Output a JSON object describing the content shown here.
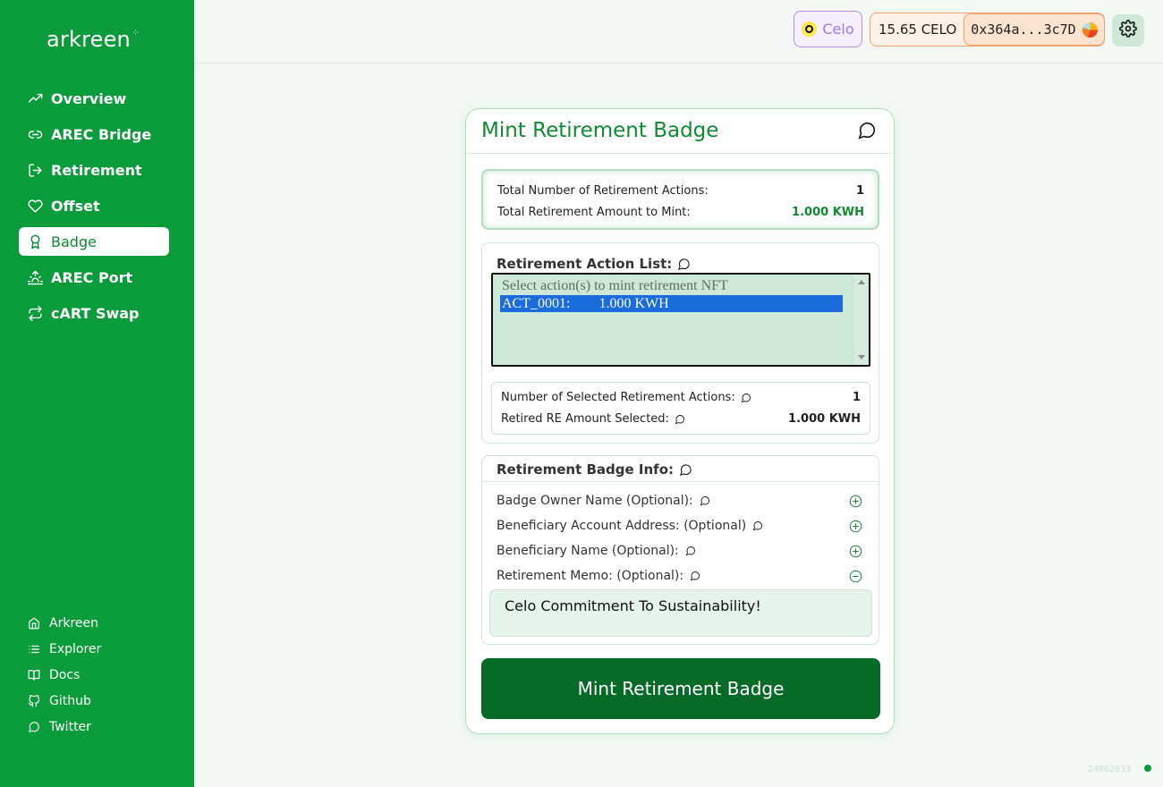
{
  "sidebar": {
    "logo": "arkreen",
    "nav": [
      {
        "label": "Overview",
        "icon": "trending-up-icon"
      },
      {
        "label": "AREC Bridge",
        "icon": "link-icon"
      },
      {
        "label": "Retirement",
        "icon": "log-out-icon"
      },
      {
        "label": "Offset",
        "icon": "heart-icon"
      },
      {
        "label": "Badge",
        "icon": "award-icon",
        "active": true
      },
      {
        "label": "AREC Port",
        "icon": "sunrise-icon"
      },
      {
        "label": "cART Swap",
        "icon": "repeat-icon"
      }
    ],
    "footer": [
      {
        "label": "Arkreen",
        "icon": "home-icon"
      },
      {
        "label": "Explorer",
        "icon": "list-icon"
      },
      {
        "label": "Docs",
        "icon": "book-icon"
      },
      {
        "label": "Github",
        "icon": "github-icon"
      },
      {
        "label": "Twitter",
        "icon": "message-circle-icon"
      }
    ]
  },
  "topbar": {
    "chain_label": "Celo",
    "balance": "15.65 CELO",
    "address": "0x364a...3c7D"
  },
  "card": {
    "title": "Mint Retirement Badge",
    "summary": {
      "actions_label": "Total Number of Retirement Actions:",
      "actions_value": "1",
      "amount_label": "Total Retirement Amount to Mint:",
      "amount_value": "1.000 KWH"
    },
    "action_list": {
      "label": "Retirement Action List:",
      "placeholder": "Select action(s) to mint retirement NFT",
      "options": [
        "ACT_0001:        1.000 KWH"
      ]
    },
    "selected": {
      "count_label": "Number of Selected Retirement Actions:",
      "count_value": "1",
      "amount_label": "Retired RE Amount Selected:",
      "amount_value": "1.000 KWH"
    },
    "badge_info": {
      "label": "Retirement Badge Info:",
      "fields": [
        {
          "label": "Badge Owner Name (Optional):",
          "action": "plus-circle-icon"
        },
        {
          "label": "Beneficiary Account Address: (Optional)",
          "action": "plus-circle-icon"
        },
        {
          "label": "Beneficiary Name (Optional):",
          "action": "plus-circle-icon"
        },
        {
          "label": "Retirement Memo: (Optional):",
          "action": "minus-circle-icon"
        }
      ],
      "memo_value": "Celo Commitment To Sustainability!"
    },
    "mint_button": "Mint Retirement Badge"
  },
  "footer": {
    "version": "24062033"
  },
  "colors": {
    "sidebar_green": "#0a9b3a",
    "title_green": "#0f8a35",
    "mint_button": "#076b28",
    "selection_blue": "#1a6bdb",
    "celo_purple": "#a277e6",
    "account_orange": "#f0a26a"
  }
}
